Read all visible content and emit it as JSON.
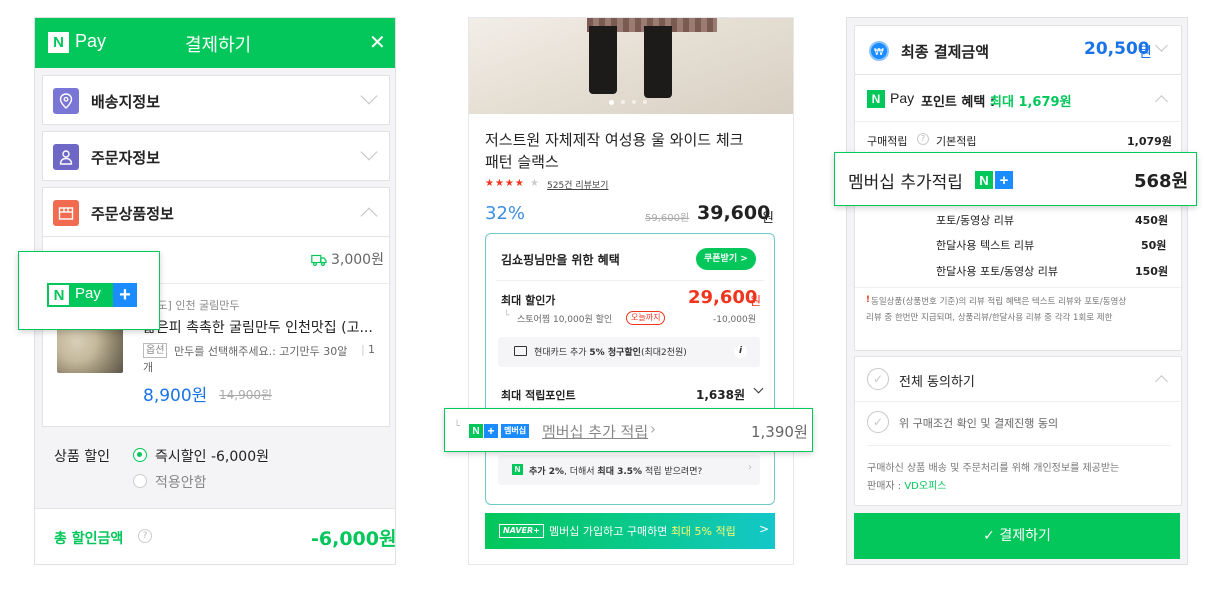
{
  "p1": {
    "header": {
      "logo_n": "N",
      "logo_pay": "Pay",
      "title": "결제하기",
      "close": "✕"
    },
    "sections": [
      {
        "label": "배송지정보"
      },
      {
        "label": "주문자정보"
      },
      {
        "label": "주문상품정보"
      }
    ],
    "shipping_fee": "3,000원",
    "product": {
      "shop": "[원도] 인천 굴림만두",
      "name": "얇은피 촉촉한 굴림만두 인천맛집 (고...",
      "option_tag": "옵션",
      "option_text": "만두를 선택해주세요.: 고기만두 30알",
      "option_qty": "1",
      "option_unit": "개",
      "price": "8,900원",
      "orig_price": "14,900원"
    },
    "discount": {
      "label": "상품 할인",
      "opt1": "즉시할인 -6,000원",
      "opt2": "적용안함"
    },
    "total": {
      "label": "총 할인금액",
      "value": "-6,000원"
    },
    "callout": {
      "n": "N",
      "pay": "Pay",
      "plus": "+"
    }
  },
  "p2": {
    "title_line1": "저스트원 자체제작 여성용 울 와이드 체크",
    "title_line2": "패턴 슬랙스",
    "stars": "★★★★",
    "star_empty": "★",
    "review_link": "525건 리뷰보기",
    "discount_pct": "32%",
    "orig_price": "59,600원",
    "price": "39,600",
    "price_unit": "원",
    "benefit_title": "김쇼핑님만을 위한 혜택",
    "coupon_btn": "쿠폰받기 >",
    "max_discount_label": "최대 할인가",
    "max_discount_value": "29,600",
    "max_discount_unit": "원",
    "store_coupon": "스토어찜 10,000원 할인",
    "today_badge": "오늘까지",
    "store_coupon_value": "-10,000원",
    "card_text_a": "현대카드 추가 ",
    "card_text_b": "5% 청구할인",
    "card_text_c": "(최대2천원)",
    "info_icon": "i",
    "max_point_label": "최대 적립포인트",
    "max_point_value": "1,638원",
    "membership_badge": "멤버십",
    "membership_label": "멤버십 추가 적립",
    "membership_value": "1,390원",
    "extra_a": "추가 2%",
    "extra_b": ", 더해서 ",
    "extra_c": "최대 3.5%",
    "extra_d": " 적립 받으려면?",
    "banner_logo": "NAVER+",
    "banner_text": "멤버십 가입하고 구매하면 ",
    "banner_highlight": "최대 5% 적립",
    "banner_arrow": ">"
  },
  "p3": {
    "final_label": "최종 결제금액",
    "final_value": "20,500",
    "final_unit": "원",
    "points_title_pay": "Pay",
    "points_title": "포인트 혜택 :",
    "points_max": "최대 1,679원",
    "buy_label": "구매적립",
    "basic_label": "기본적립",
    "basic_value": "1,079원",
    "callout_label": "멤버십 추가적립",
    "callout_value": "568원",
    "reviews": [
      {
        "label": "포토/동영상 리뷰",
        "value": "450원"
      },
      {
        "label": "한달사용 텍스트 리뷰",
        "value": "50원"
      },
      {
        "label": "한달사용 포토/동영상 리뷰",
        "value": "150원"
      }
    ],
    "notice_mark": "!",
    "notice1": "동일상품(상품번호 기준)의 리뷰 적립 혜택은 텍스트 리뷰와 포토/동영상",
    "notice2": "리뷰 중 한번만 지급되며, 상품리뷰/한달사용 리뷰 중 각각 1회로 제한",
    "agree_all": "전체 동의하기",
    "agree_item": "위 구매조건 확인 및 결제진행 동의",
    "privacy1": "구매하신 상품 배송 및 주문처리를 위해 개인정보를 제공받는",
    "privacy2_a": "판매자 : ",
    "privacy2_b": "VD오피스",
    "pay_button": "✓ 결제하기"
  },
  "colors": {
    "naver_green": "#03c75a",
    "plus_blue": "#1a8cff",
    "price_red": "#f0341e"
  }
}
